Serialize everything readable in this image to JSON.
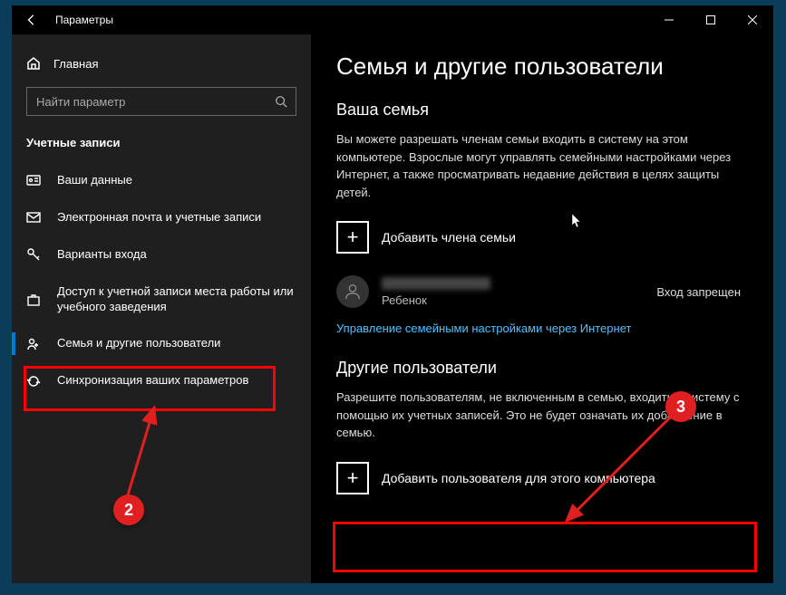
{
  "titlebar": {
    "title": "Параметры"
  },
  "sidebar": {
    "home": "Главная",
    "search_placeholder": "Найти параметр",
    "section": "Учетные записи",
    "items": [
      {
        "label": "Ваши данные"
      },
      {
        "label": "Электронная почта и учетные записи"
      },
      {
        "label": "Варианты входа"
      },
      {
        "label": "Доступ к учетной записи места работы или учебного заведения"
      },
      {
        "label": "Семья и другие пользователи"
      },
      {
        "label": "Синхронизация ваших параметров"
      }
    ]
  },
  "main": {
    "heading": "Семья и другие пользователи",
    "family_heading": "Ваша семья",
    "family_desc": "Вы можете разрешать членам семьи входить в систему на этом компьютере. Взрослые могут управлять семейными настройками через Интернет, а также просматривать недавние действия в целях защиты детей.",
    "add_family": "Добавить члена семьи",
    "member_role": "Ребенок",
    "member_status": "Вход запрещен",
    "manage_link": "Управление семейными настройками через Интернет",
    "others_heading": "Другие пользователи",
    "others_desc": "Разрешите пользователям, не включенным в семью, входить в систему с помощью их учетных записей. Это не будет означать их добавление в семью.",
    "add_other": "Добавить пользователя для этого компьютера"
  },
  "annotations": {
    "num2": "2",
    "num3": "3"
  }
}
